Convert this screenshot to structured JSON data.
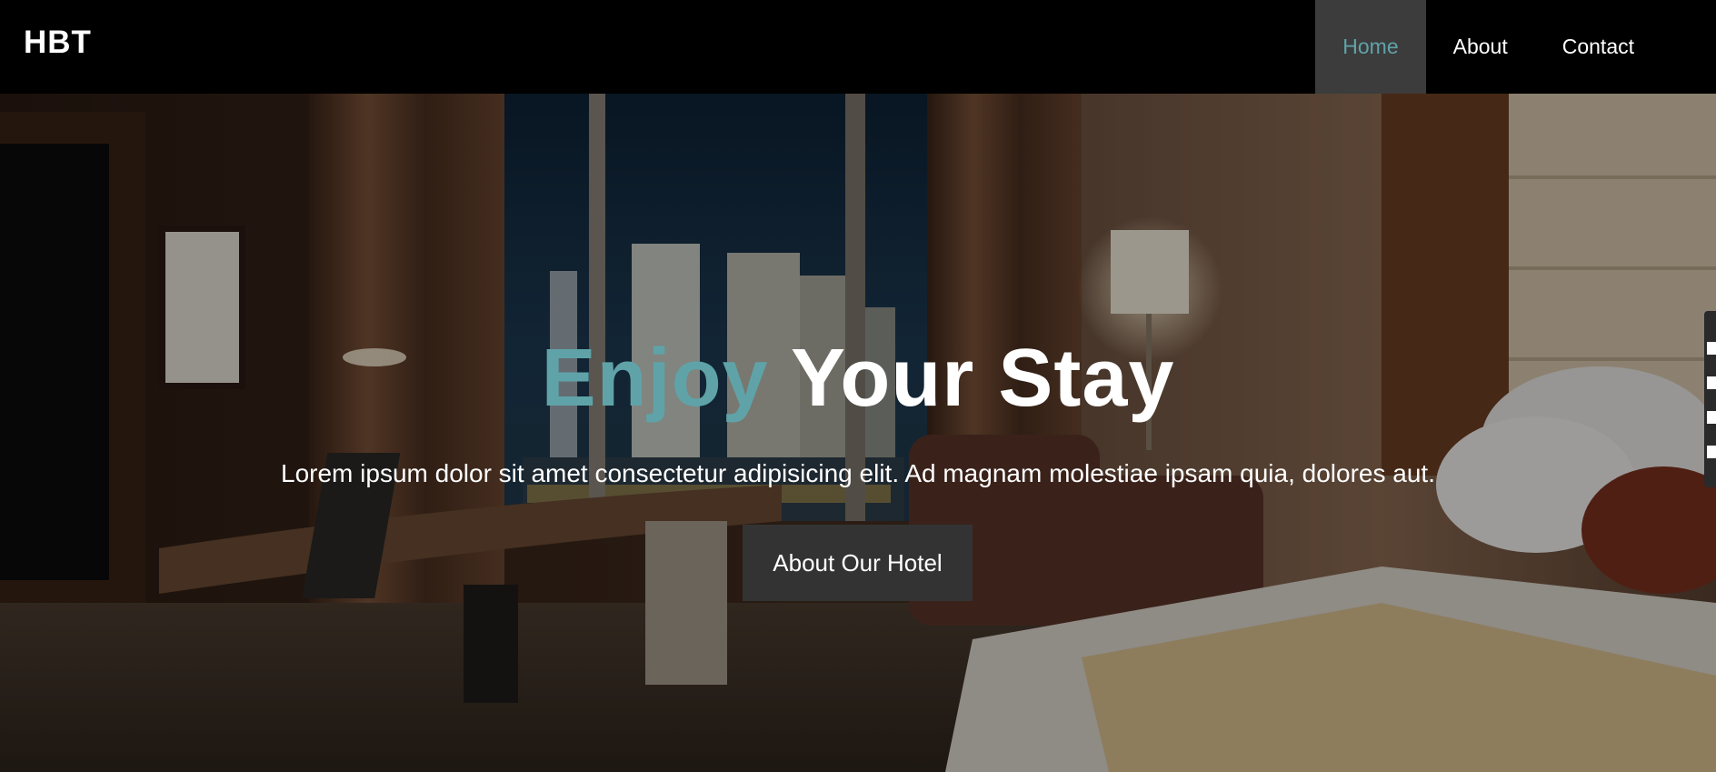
{
  "navbar": {
    "brand": "HBT",
    "links": [
      {
        "label": "Home",
        "active": true
      },
      {
        "label": "About",
        "active": false
      },
      {
        "label": "Contact",
        "active": false
      }
    ]
  },
  "hero": {
    "title_accent": "Enjoy",
    "title_rest": " Your Stay",
    "subtitle": "Lorem ipsum dolor sit amet consectetur adipisicing elit. Ad magnam molestiae ipsam quia, dolores aut.",
    "button_label": "About Our Hotel"
  },
  "colors": {
    "accent": "#5fa3a8",
    "navbar_bg": "#000000",
    "active_nav_bg": "#3c3c3c",
    "button_bg": "#333333"
  },
  "icons": [
    "side-toolbar-widget"
  ]
}
